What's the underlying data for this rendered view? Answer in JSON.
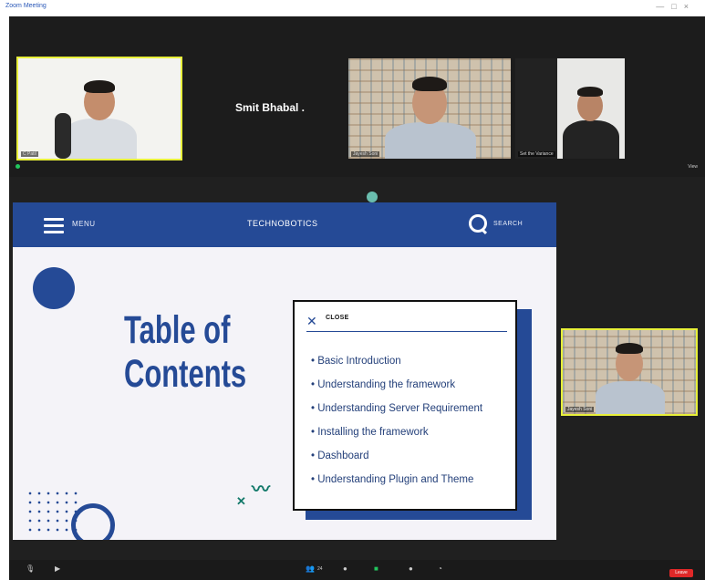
{
  "page": {
    "top_text": "g"
  },
  "window": {
    "title": "Zoom Meeting",
    "controls": [
      "—",
      "□",
      "×"
    ]
  },
  "gallery": {
    "tiles": [
      {
        "name": "C Patil",
        "active": true
      },
      {
        "name": "Smit Bhabal .",
        "video": false
      },
      {
        "name": "Jayesh Soni"
      },
      {
        "name": "Set the Variance"
      }
    ]
  },
  "share": {
    "view_label": "View"
  },
  "slide": {
    "menu_label": "MENU",
    "brand": "TECHNOBOTICS",
    "search_label": "SEARCH",
    "title_line1": "Table of",
    "title_line2": "Contents",
    "popup": {
      "close_label": "CLOSE",
      "items": [
        "• Basic Introduction",
        "• Understanding the framework",
        "• Understanding Server Requirement",
        "• Installing the framework",
        "• Dashboard",
        "•  Understanding Plugin and Theme"
      ]
    },
    "colors": {
      "primary": "#254a96",
      "accent": "#13796a",
      "background": "#f4f3f8"
    }
  },
  "self_view": {
    "name": "Jayesh Soni"
  },
  "toolbar": {
    "icons": [
      "microphone-icon",
      "video-icon",
      "participants-icon",
      "chat-icon",
      "share-screen-icon",
      "record-icon",
      "reactions-icon"
    ],
    "participants_count": "24",
    "leave_label": "Leave"
  }
}
